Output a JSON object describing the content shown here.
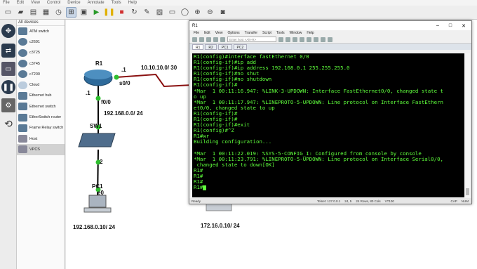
{
  "app": {
    "menu": [
      "File",
      "Edit",
      "View",
      "Control",
      "Device",
      "Annotate",
      "Tools",
      "Help"
    ]
  },
  "devices": {
    "title": "All devices",
    "items": [
      {
        "label": "ATM switch"
      },
      {
        "label": "c2691"
      },
      {
        "label": "c3725"
      },
      {
        "label": "c3745"
      },
      {
        "label": "c7200"
      },
      {
        "label": "Cloud"
      },
      {
        "label": "Ethernet hub"
      },
      {
        "label": "Ethernet switch"
      },
      {
        "label": "EtherSwitch router"
      },
      {
        "label": "Frame Relay switch"
      },
      {
        "label": "Host"
      },
      {
        "label": "VPCS"
      }
    ]
  },
  "topology": {
    "r1": "R1",
    "r1_port_s00": "s0/0",
    "r1_dot1a": ".1",
    "r1_dot1b": ".1",
    "link_net": "10.10.10.0/ 30",
    "f00": "f0/0",
    "lan": "192.168.0.0/ 24",
    "sw": "SW1",
    "sw_port": "2",
    "pc": "PC1",
    "pc_port": "e0",
    "pc_net": "192.168.0.10/ 24",
    "remote_net": "172.16.0.10/ 24"
  },
  "terminal_window": {
    "title": "R1",
    "menu": [
      "File",
      "Edit",
      "View",
      "Options",
      "Transfer",
      "Script",
      "Tools",
      "Window",
      "Help"
    ],
    "host_placeholder": "Enter host <Alt+R>",
    "tabs": [
      "R1",
      "R2",
      "PC1",
      "PC2"
    ],
    "lines": [
      "R1(config)#interface fastEthernet 0/0",
      "R1(config-if)#ip add",
      "R1(config-if)#ip address 192.168.0.1 255.255.255.0",
      "R1(config-if)#no shut",
      "R1(config-if)#no shutdown",
      "R1(config-if)#",
      "*Mar  1 00:11:16.947: %LINK-3-UPDOWN: Interface FastEthernet0/0, changed state t",
      "o up",
      "*Mar  1 00:11:17.947: %LINEPROTO-5-UPDOWN: Line protocol on Interface FastEthern",
      "et0/0, changed state to up",
      "R1(config-if)#",
      "R1(config-if)#",
      "R1(config-if)#exit",
      "R1(config)#^Z",
      "R1#wr",
      "Building configuration...",
      "",
      "*Mar  1 00:11:22.019: %SYS-5-CONFIG_I: Configured from console by console",
      "*Mar  1 00:11:23.791: %LINEPROTO-5-UPDOWN: Line protocol on Interface Serial0/0,",
      " changed state to down[OK]",
      "R1#",
      "R1#",
      "R1#",
      "R1#"
    ],
    "status": [
      "Ready",
      "Telnet: 127.0.0.1",
      "24,  5",
      "24 Rows, 80 Cols",
      "VT100",
      "CAP",
      "NUM"
    ]
  }
}
